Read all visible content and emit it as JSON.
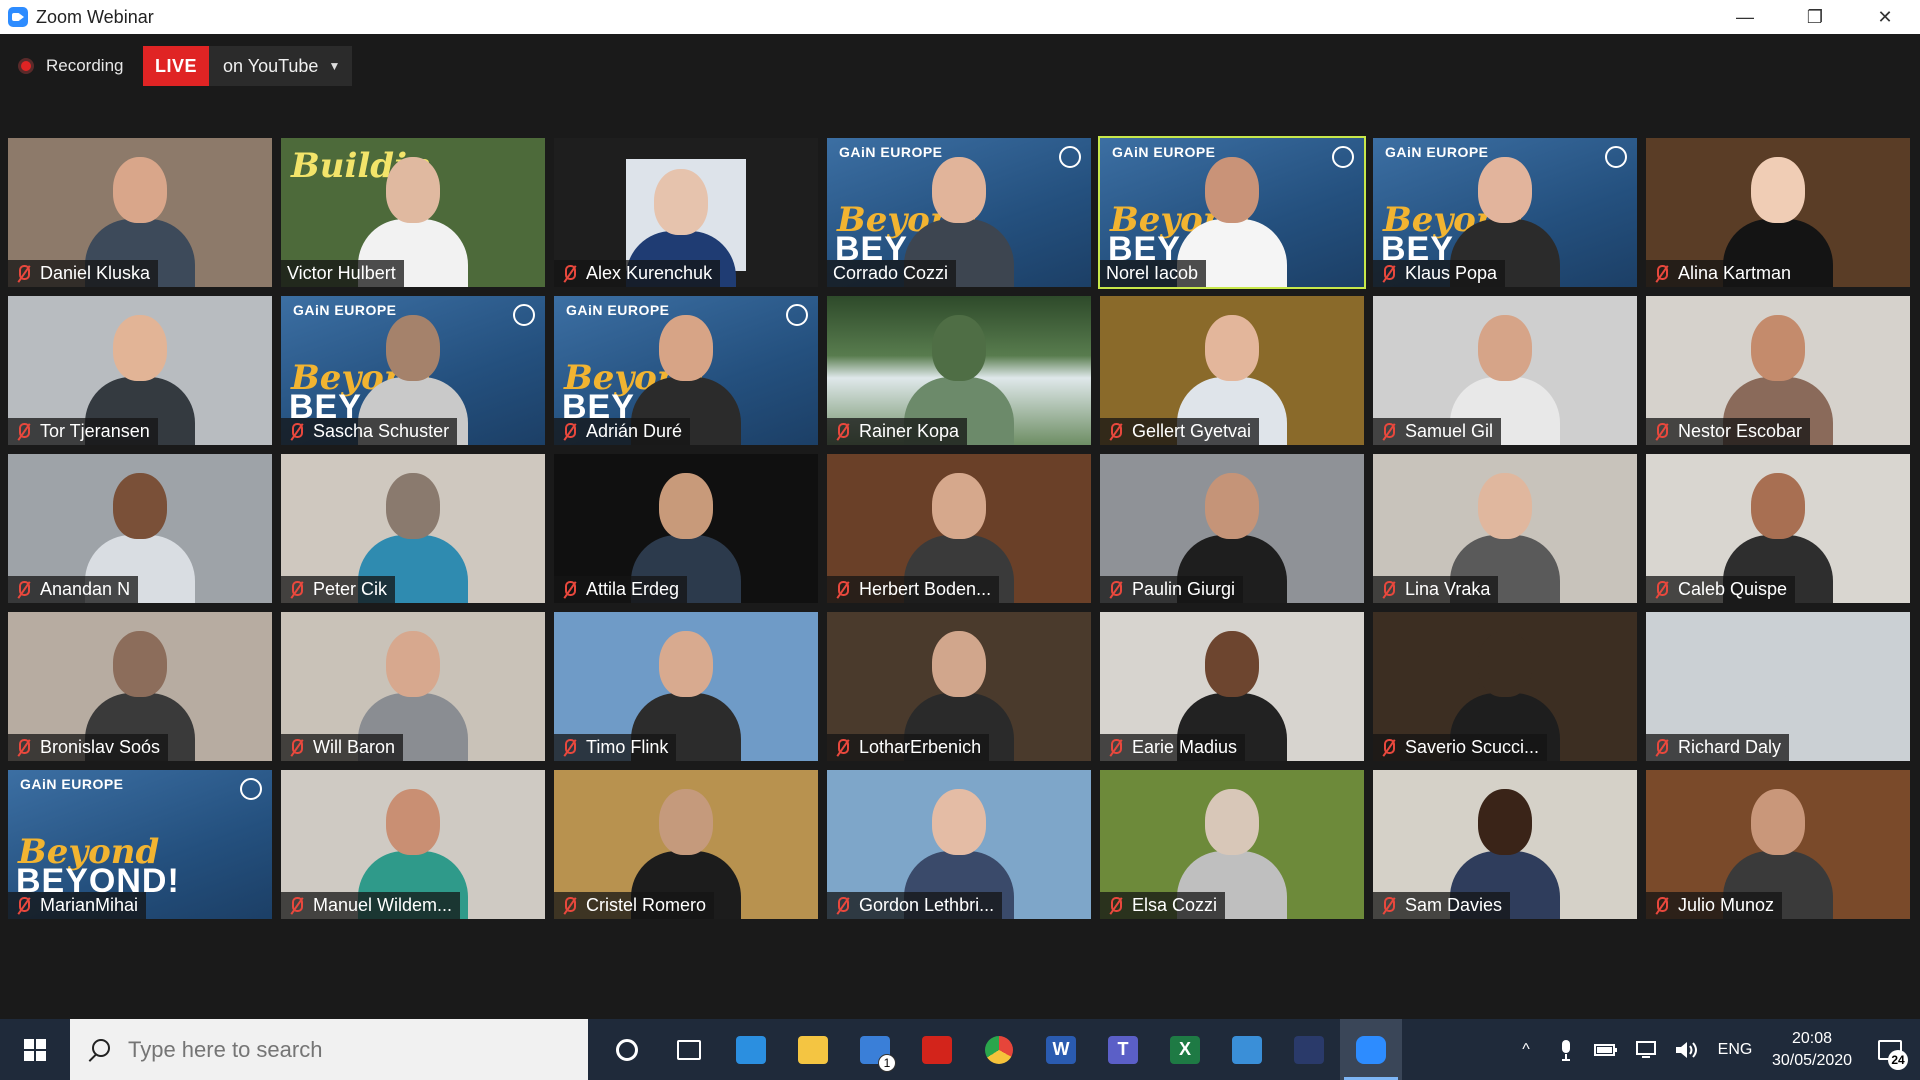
{
  "window": {
    "title": "Zoom Webinar",
    "controls": {
      "minimize": "—",
      "restore": "❐",
      "close": "✕"
    }
  },
  "recording": {
    "label": "Recording"
  },
  "live": {
    "badge": "LIVE",
    "destination": "on YouTube",
    "caret": "▼"
  },
  "participants": [
    {
      "name": "Daniel Kluska",
      "bg": "#8d7a6a",
      "skin": "#d9a68a",
      "shirt": "#3d4a5a",
      "muted": true
    },
    {
      "name": "Victor Hulbert",
      "bg": "#4d6a3a",
      "skin": "#e0b9a0",
      "shirt": "#f2f2f2",
      "muted": false,
      "banner": "Buildin"
    },
    {
      "name": "Alex Kurenchuk",
      "bg": "#1e1e1e",
      "skin": "#e6c3ad",
      "shirt": "#1f3c73",
      "muted": true,
      "inset": true
    },
    {
      "name": "Corrado Cozzi",
      "bg": "#2f5b8a",
      "skin": "#e1b49a",
      "shirt": "#3d4550",
      "muted": false,
      "gain": true
    },
    {
      "name": "Norel Iacob",
      "bg": "#2f5b8a",
      "skin": "#c99378",
      "shirt": "#f5f5f5",
      "muted": false,
      "gain": true,
      "active": true
    },
    {
      "name": "Klaus Popa",
      "bg": "#2f5b8a",
      "skin": "#e2b49c",
      "shirt": "#2b2b2b",
      "muted": true,
      "gain": true
    },
    {
      "name": "Alina Kartman",
      "bg": "#5a3d26",
      "skin": "#f0cdb5",
      "shirt": "#141414",
      "muted": true
    },
    {
      "name": "Tor Tjeransen",
      "bg": "#b8bcc0",
      "skin": "#e2b496",
      "shirt": "#343a40",
      "muted": true
    },
    {
      "name": "Sascha Schuster",
      "bg": "#2f5b8a",
      "skin": "#a5826b",
      "shirt": "#c9c9c9",
      "muted": true,
      "gain": true
    },
    {
      "name": "Adrián Duré",
      "bg": "#2f5b8a",
      "skin": "#d7a486",
      "shirt": "#2b2b2b",
      "muted": true,
      "gain": true
    },
    {
      "name": "Rainer Kopa",
      "bg": "#4f6e45",
      "skin": "#4f6e45",
      "shirt": "#6c8a6a",
      "muted": true,
      "scene": "waterfall"
    },
    {
      "name": "Gellert Gyetvai",
      "bg": "#8a6a2a",
      "skin": "#e3b69b",
      "shirt": "#dfe4ea",
      "muted": true
    },
    {
      "name": "Samuel Gil",
      "bg": "#cfcfcf",
      "skin": "#d6a488",
      "shirt": "#e8e8e8",
      "muted": true
    },
    {
      "name": "Nestor Escobar",
      "bg": "#d6d2cc",
      "skin": "#c48b6c",
      "shirt": "#8a6a5a",
      "muted": true
    },
    {
      "name": "Anandan N",
      "bg": "#9ea3a8",
      "skin": "#7a5038",
      "shirt": "#d9dde2",
      "muted": true
    },
    {
      "name": "Peter Cik",
      "bg": "#cfc8bf",
      "skin": "#8a7a6e",
      "shirt": "#2f8bb0",
      "muted": true
    },
    {
      "name": "Attila Erdeg",
      "bg": "#101010",
      "skin": "#c89a7a",
      "shirt": "#2c3a4c",
      "muted": true
    },
    {
      "name": "Herbert Boden...",
      "bg": "#6a4028",
      "skin": "#d6a88c",
      "shirt": "#3a3a3a",
      "muted": true
    },
    {
      "name": "Paulin Giurgi",
      "bg": "#8f9297",
      "skin": "#c59478",
      "shirt": "#1e1e1e",
      "muted": true
    },
    {
      "name": "Lina Vraka",
      "bg": "#c8c3bb",
      "skin": "#e0b79e",
      "shirt": "#5a5a5a",
      "muted": true
    },
    {
      "name": "Caleb Quispe",
      "bg": "#d9d6d0",
      "skin": "#a86f52",
      "shirt": "#2e2e2e",
      "muted": true
    },
    {
      "name": "Bronislav Soós",
      "bg": "#b7aca1",
      "skin": "#8c6d5b",
      "shirt": "#3a3a3a",
      "muted": true
    },
    {
      "name": "Will Baron",
      "bg": "#c9c2b8",
      "skin": "#d7a88e",
      "shirt": "#8a8d92",
      "muted": true
    },
    {
      "name": "Timo Flink",
      "bg": "#6f9bc7",
      "skin": "#d8aa8f",
      "shirt": "#2c2c2c",
      "muted": true
    },
    {
      "name": "LotharErbenich",
      "bg": "#4a3a2c",
      "skin": "#d1a68c",
      "shirt": "#2a2a2a",
      "muted": true
    },
    {
      "name": "Earie Madius",
      "bg": "#d7d4cf",
      "skin": "#6d452f",
      "shirt": "#222222",
      "muted": true
    },
    {
      "name": "Saverio Scucci...",
      "bg": "#3c2e22",
      "skin": "#3c2e22",
      "shirt": "#1e1e1e",
      "muted": true
    },
    {
      "name": "Richard Daly",
      "bg": "#cbd0d4",
      "skin": "#cbd0d4",
      "shirt": "#cbd0d4",
      "muted": true
    },
    {
      "name": "MarianMihai",
      "bg": "#2f5b8a",
      "skin": "#2f5b8a",
      "shirt": "#2f5b8a",
      "muted": true,
      "gain": true,
      "logo_only": true
    },
    {
      "name": "Manuel Wildem...",
      "bg": "#cfcac3",
      "skin": "#c98f73",
      "shirt": "#2f9a8a",
      "muted": true
    },
    {
      "name": "Cristel Romero",
      "bg": "#b8924f",
      "skin": "#c59a7c",
      "shirt": "#1c1c1c",
      "muted": true
    },
    {
      "name": "Gordon Lethbri...",
      "bg": "#7ea6c9",
      "skin": "#e4bca5",
      "shirt": "#3a4a6a",
      "muted": true
    },
    {
      "name": "Elsa Cozzi",
      "bg": "#6d8a3a",
      "skin": "#d8c7b8",
      "shirt": "#bfbfbf",
      "muted": true
    },
    {
      "name": "Sam Davies",
      "bg": "#d5d1c8",
      "skin": "#3a2418",
      "shirt": "#2f3d5c",
      "muted": true
    },
    {
      "name": "Julio Munoz",
      "bg": "#7a4a2a",
      "skin": "#c9977a",
      "shirt": "#3a3a3a",
      "muted": true
    }
  ],
  "gain_text": {
    "brand": "GAiN EUROPE",
    "script": "Beyond",
    "big": "BEYOND!"
  },
  "taskbar": {
    "search_placeholder": "Type here to search",
    "apps": [
      {
        "name": "cortana-icon",
        "color": "#ffffff",
        "shape": "ring"
      },
      {
        "name": "task-view-icon",
        "color": "#ffffff",
        "shape": "taskview"
      },
      {
        "name": "edge-icon",
        "color": "#2b8fe0",
        "shape": "e"
      },
      {
        "name": "file-explorer-icon",
        "color": "#f4c542",
        "shape": "folder"
      },
      {
        "name": "mail-icon",
        "color": "#3a7fd8",
        "shape": "mail",
        "badge": "1"
      },
      {
        "name": "acrobat-icon",
        "color": "#d3241b",
        "shape": "acrobat"
      },
      {
        "name": "chrome-icon",
        "color": "#e6453a",
        "shape": "chrome"
      },
      {
        "name": "word-icon",
        "color": "#2a5bb0",
        "shape": "W"
      },
      {
        "name": "teams-icon",
        "color": "#5b5fc7",
        "shape": "T"
      },
      {
        "name": "excel-icon",
        "color": "#1e7a44",
        "shape": "X"
      },
      {
        "name": "photos-icon",
        "color": "#3a8fd8",
        "shape": "photo"
      },
      {
        "name": "app-icon",
        "color": "#2a3a6a",
        "shape": "hex"
      },
      {
        "name": "zoom-icon",
        "color": "#2d8cff",
        "shape": "zoom",
        "active": true
      }
    ],
    "tray": {
      "chevron": "^",
      "language": "ENG",
      "time": "20:08",
      "date": "30/05/2020",
      "notifications": "24"
    }
  }
}
